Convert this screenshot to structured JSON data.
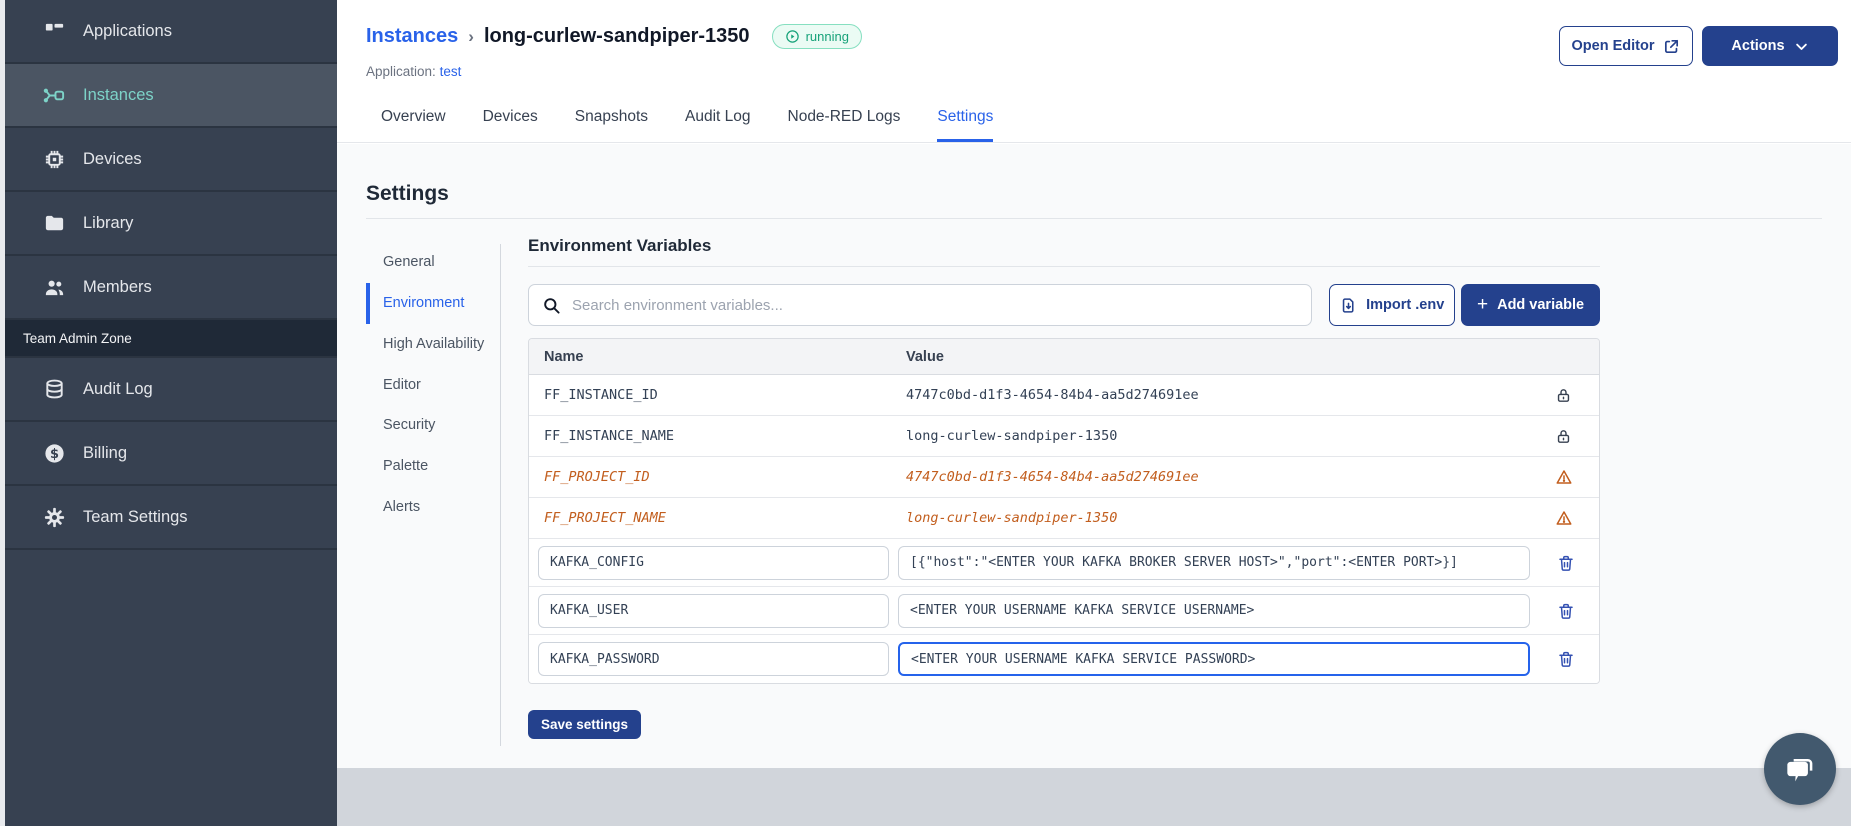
{
  "sidebar": {
    "items": [
      {
        "label": "Applications",
        "icon": "applications-icon",
        "active": false
      },
      {
        "label": "Instances",
        "icon": "instances-icon",
        "active": true
      },
      {
        "label": "Devices",
        "icon": "devices-icon",
        "active": false
      },
      {
        "label": "Library",
        "icon": "library-icon",
        "active": false
      },
      {
        "label": "Members",
        "icon": "members-icon",
        "active": false
      }
    ],
    "section_label": "Team Admin Zone",
    "admin_items": [
      {
        "label": "Audit Log",
        "icon": "audit-log-icon"
      },
      {
        "label": "Billing",
        "icon": "billing-icon"
      },
      {
        "label": "Team Settings",
        "icon": "team-settings-icon"
      }
    ]
  },
  "header": {
    "breadcrumb_parent": "Instances",
    "breadcrumb_separator": "›",
    "instance_name": "long-curlew-sandpiper-1350",
    "status_badge": "running",
    "application_label": "Application:",
    "application_name": "test",
    "open_editor_label": "Open Editor",
    "actions_label": "Actions"
  },
  "tabs": [
    {
      "label": "Overview"
    },
    {
      "label": "Devices"
    },
    {
      "label": "Snapshots"
    },
    {
      "label": "Audit Log"
    },
    {
      "label": "Node-RED Logs"
    },
    {
      "label": "Settings"
    }
  ],
  "settings": {
    "title": "Settings",
    "nav": [
      {
        "label": "General"
      },
      {
        "label": "Environment",
        "active": true
      },
      {
        "label": "High Availability"
      },
      {
        "label": "Editor"
      },
      {
        "label": "Security"
      },
      {
        "label": "Palette"
      },
      {
        "label": "Alerts"
      }
    ]
  },
  "env": {
    "title": "Environment Variables",
    "search_placeholder": "Search environment variables...",
    "import_button": "Import .env",
    "add_button": "Add variable",
    "add_plus": "+",
    "columns": {
      "name": "Name",
      "value": "Value"
    },
    "rows": [
      {
        "name": "FF_INSTANCE_ID",
        "value": "4747c0bd-d1f3-4654-84b4-aa5d274691ee",
        "state": "locked"
      },
      {
        "name": "FF_INSTANCE_NAME",
        "value": "long-curlew-sandpiper-1350",
        "state": "locked"
      },
      {
        "name": "FF_PROJECT_ID",
        "value": "4747c0bd-d1f3-4654-84b4-aa5d274691ee",
        "state": "deprecated"
      },
      {
        "name": "FF_PROJECT_NAME",
        "value": "long-curlew-sandpiper-1350",
        "state": "deprecated"
      },
      {
        "name": "KAFKA_CONFIG",
        "value": "[{\"host\":\"<ENTER YOUR KAFKA BROKER SERVER HOST>\",\"port\":<ENTER PORT>}]",
        "state": "editable"
      },
      {
        "name": "KAFKA_USER",
        "value": "<ENTER YOUR USERNAME KAFKA SERVICE USERNAME>",
        "state": "editable"
      },
      {
        "name": "KAFKA_PASSWORD",
        "value": "<ENTER YOUR USERNAME KAFKA SERVICE PASSWORD>",
        "state": "editable-focused"
      }
    ],
    "save_button": "Save settings"
  },
  "colors": {
    "sidebar_bg": "#374151",
    "sidebar_active_bg": "#4B5563",
    "sidebar_active_text": "#7DD3C8",
    "admin_zone_bg": "#1F2937",
    "link_blue": "#2962E9",
    "button_navy": "#24418D",
    "running_green": "#17A279",
    "deprecated_orange": "#C25E1E",
    "footer_gray": "#D1D5DB",
    "chat_slate": "#42596E"
  }
}
